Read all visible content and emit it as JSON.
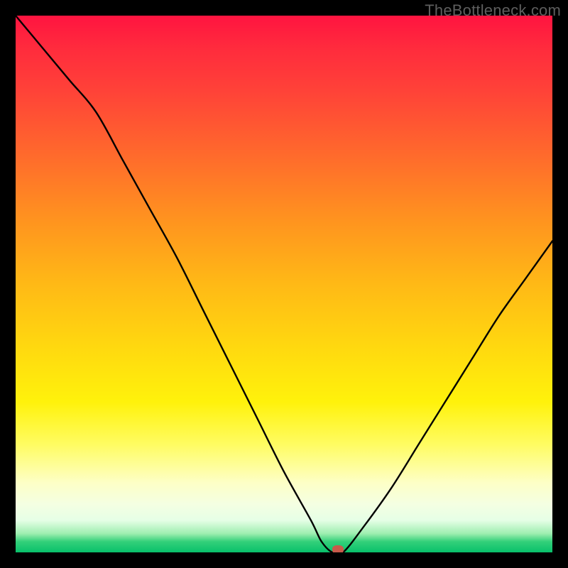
{
  "watermark": "TheBottleneck.com",
  "chart_data": {
    "type": "line",
    "title": "",
    "xlabel": "",
    "ylabel": "",
    "xlim": [
      0,
      100
    ],
    "ylim": [
      0,
      100
    ],
    "grid": false,
    "legend": false,
    "background": {
      "type": "vertical-gradient",
      "stops": [
        {
          "pos": 0,
          "color": "#ff1440"
        },
        {
          "pos": 26,
          "color": "#ff6a2c"
        },
        {
          "pos": 50,
          "color": "#ffb916"
        },
        {
          "pos": 72,
          "color": "#fff20b"
        },
        {
          "pos": 91,
          "color": "#f4ffe2"
        },
        {
          "pos": 100,
          "color": "#08c06a"
        }
      ]
    },
    "series": [
      {
        "name": "bottleneck-curve",
        "color": "#000000",
        "x": [
          0,
          5,
          10,
          15,
          20,
          25,
          30,
          35,
          40,
          45,
          50,
          55,
          57,
          59,
          61,
          65,
          70,
          75,
          80,
          85,
          90,
          95,
          100
        ],
        "y": [
          100,
          94,
          88,
          82,
          73,
          64,
          55,
          45,
          35,
          25,
          15,
          6,
          2,
          0,
          0,
          5,
          12,
          20,
          28,
          36,
          44,
          51,
          58
        ]
      }
    ],
    "markers": [
      {
        "name": "optimal-point",
        "x": 60,
        "y": 0,
        "color": "#c85a4a"
      }
    ]
  }
}
